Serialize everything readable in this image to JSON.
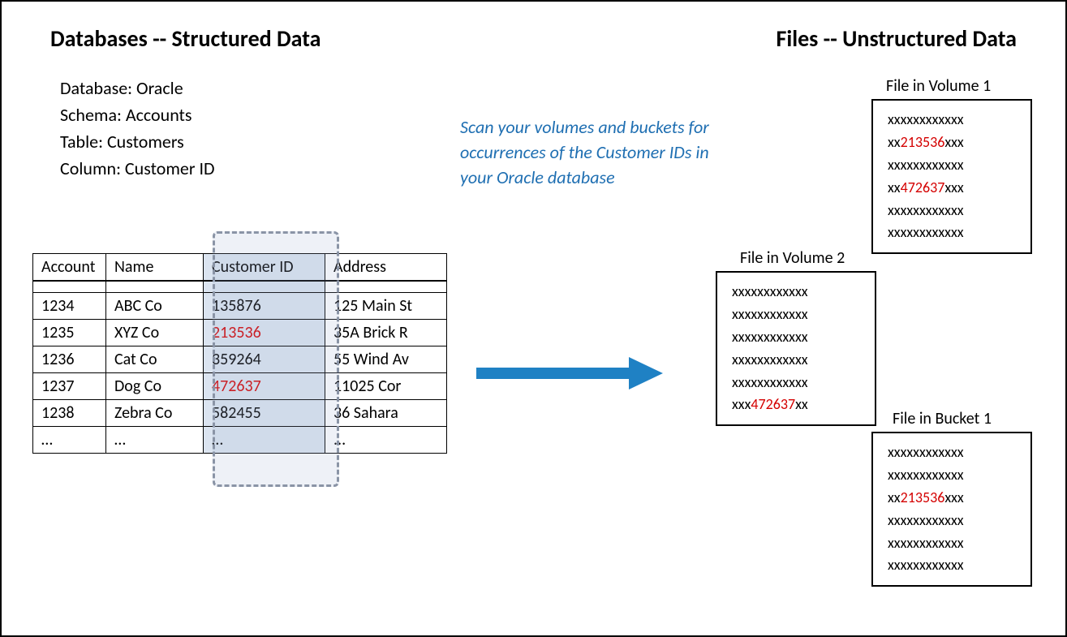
{
  "headings": {
    "left": "Databases -- Structured Data",
    "right": "Files -- Unstructured Data"
  },
  "metadata": {
    "line1": "Database: Oracle",
    "line2": "Schema: Accounts",
    "line3": "Table: Customers",
    "line4": "Column: Customer ID"
  },
  "callout": "Scan your volumes and buckets for occurrences of the Customer IDs in your Oracle database",
  "table": {
    "headers": {
      "account": "Account",
      "name": "Name",
      "cid": "Customer ID",
      "address": "Address"
    },
    "rows": [
      {
        "account": "1234",
        "name": "ABC Co",
        "cid": "135876",
        "address": "125 Main St",
        "cid_red": false
      },
      {
        "account": "1235",
        "name": "XYZ Co",
        "cid": "213536",
        "address": "35A Brick R",
        "cid_red": true
      },
      {
        "account": "1236",
        "name": "Cat Co",
        "cid": "359264",
        "address": "55 Wind Av",
        "cid_red": false
      },
      {
        "account": "1237",
        "name": "Dog Co",
        "cid": "472637",
        "address": "11025 Cor",
        "cid_red": true
      },
      {
        "account": "1238",
        "name": "Zebra Co",
        "cid": "582455",
        "address": "36 Sahara",
        "cid_red": false
      },
      {
        "account": "…",
        "name": "…",
        "cid": "…",
        "address": "...",
        "cid_red": false
      }
    ]
  },
  "files": {
    "vol1": {
      "label": "File in Volume 1",
      "lines": [
        [
          {
            "t": "xxxxxxxxxxxx",
            "red": false
          }
        ],
        [
          {
            "t": "xx",
            "red": false
          },
          {
            "t": "213536",
            "red": true
          },
          {
            "t": "xxx",
            "red": false
          }
        ],
        [
          {
            "t": "xxxxxxxxxxxx",
            "red": false
          }
        ],
        [
          {
            "t": "xx",
            "red": false
          },
          {
            "t": "472637",
            "red": true
          },
          {
            "t": "xxx",
            "red": false
          }
        ],
        [
          {
            "t": "xxxxxxxxxxxx",
            "red": false
          }
        ],
        [
          {
            "t": "xxxxxxxxxxxx",
            "red": false
          }
        ]
      ]
    },
    "vol2": {
      "label": "File in Volume 2",
      "lines": [
        [
          {
            "t": "xxxxxxxxxxxx",
            "red": false
          }
        ],
        [
          {
            "t": "xxxxxxxxxxxx",
            "red": false
          }
        ],
        [
          {
            "t": "xxxxxxxxxxxx",
            "red": false
          }
        ],
        [
          {
            "t": "xxxxxxxxxxxx",
            "red": false
          }
        ],
        [
          {
            "t": "xxxxxxxxxxxx",
            "red": false
          }
        ],
        [
          {
            "t": "xxx",
            "red": false
          },
          {
            "t": "472637",
            "red": true
          },
          {
            "t": "xx",
            "red": false
          }
        ]
      ]
    },
    "bucket1": {
      "label": "File in Bucket 1",
      "lines": [
        [
          {
            "t": "xxxxxxxxxxxx",
            "red": false
          }
        ],
        [
          {
            "t": "xxxxxxxxxxxx",
            "red": false
          }
        ],
        [
          {
            "t": "xx",
            "red": false
          },
          {
            "t": "213536",
            "red": true
          },
          {
            "t": "xxx",
            "red": false
          }
        ],
        [
          {
            "t": "xxxxxxxxxxxx",
            "red": false
          }
        ],
        [
          {
            "t": "xxxxxxxxxxxx",
            "red": false
          }
        ],
        [
          {
            "t": "xxxxxxxxxxxx",
            "red": false
          }
        ]
      ]
    }
  }
}
